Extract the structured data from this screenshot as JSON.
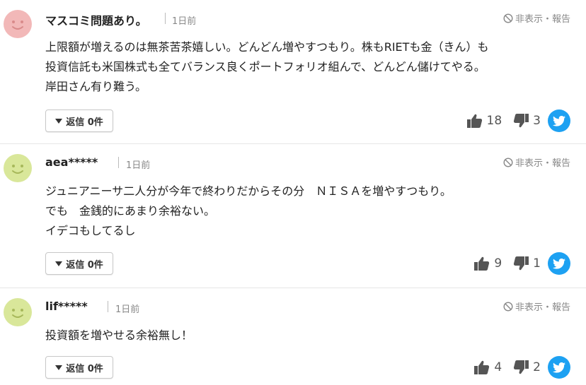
{
  "report_label": "非表示・報告",
  "colors": {
    "twitter": "#1da1f2",
    "avatar_pink": "#f2b8b8",
    "avatar_green": "#d9e79a"
  },
  "comments": [
    {
      "author": "マスコミ問題あり。",
      "time": "1日前",
      "avatar_icon": "face-icon",
      "lines": [
        "上限額が増えるのは無茶苦茶嬉しい。どんどん増やすつもり。株もRIETも金（きん）も",
        "投資信託も米国株式も全てバランス良くポートフォリオ組んで、どんどん儲けてやる。",
        "岸田さん有り難う。"
      ],
      "reply_label": "返信 0件",
      "likes": "18",
      "dislikes": "3"
    },
    {
      "author": "aea*****",
      "time": "1日前",
      "avatar_icon": "face-icon",
      "lines": [
        "ジュニアニーサ二人分が今年で終わりだからその分　ＮＩＳＡを増やすつもり。",
        "でも　金銭的にあまり余裕ない。",
        "イデコもしてるし"
      ],
      "reply_label": "返信 0件",
      "likes": "9",
      "dislikes": "1"
    },
    {
      "author": "lif*****",
      "time": "1日前",
      "avatar_icon": "face-icon",
      "lines": [
        "投資額を増やせる余裕無し！"
      ],
      "reply_label": "返信 0件",
      "likes": "4",
      "dislikes": "2"
    }
  ]
}
